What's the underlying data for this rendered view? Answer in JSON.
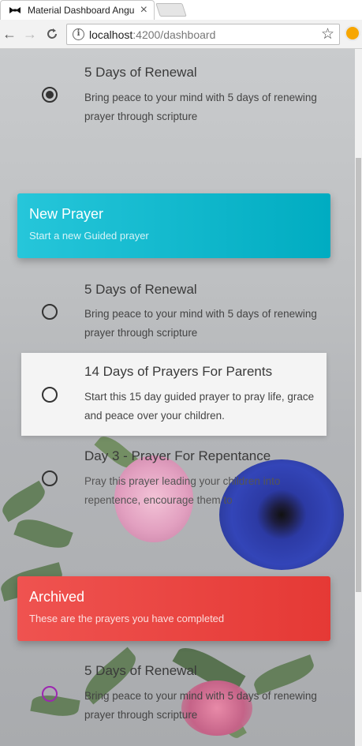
{
  "browser": {
    "tab_title": "Material Dashboard Angu",
    "url_host": "localhost",
    "url_rest": ":4200/dashboard"
  },
  "prayers_top": [
    {
      "title": "5 Days of Renewal",
      "desc": "Bring peace to your mind with 5 days of renewing prayer through scripture",
      "checked": true
    }
  ],
  "new_prayer": {
    "title": "New Prayer",
    "subtitle": "Start a new Guided prayer",
    "items": [
      {
        "title": "5 Days of Renewal",
        "desc": "Bring peace to your mind with 5 days of renewing prayer through scripture"
      },
      {
        "title": "14 Days of Prayers For Parents",
        "desc": "Start this 15 day guided prayer to pray life, grace and peace over your children."
      },
      {
        "title": "Day 3 - Prayer For Repentance",
        "desc": "Pray this prayer leading your children into repentence, encourage them to"
      }
    ]
  },
  "archived": {
    "title": "Archived",
    "subtitle": "These are the prayers you have completed",
    "items": [
      {
        "title": "5 Days of Renewal",
        "desc": "Bring peace to your mind with 5 days of renewing prayer through scripture"
      }
    ]
  }
}
